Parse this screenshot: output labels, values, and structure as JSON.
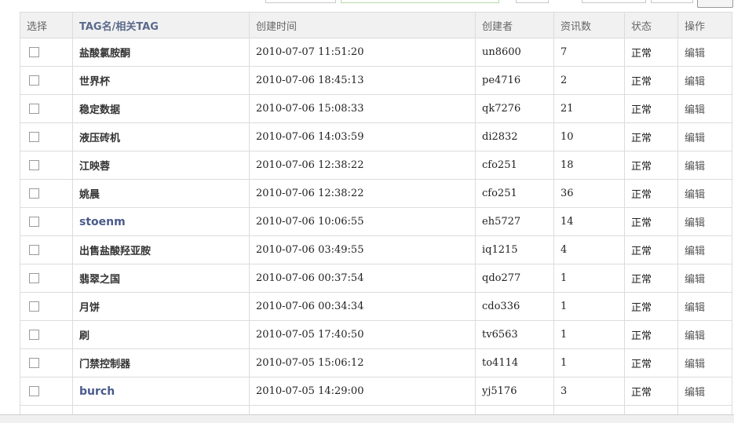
{
  "table": {
    "headers": {
      "select": "选择",
      "tag": "TAG名/相关TAG",
      "created": "创建时间",
      "creator": "创建者",
      "count": "资讯数",
      "status": "状态",
      "action": "操作"
    },
    "rows": [
      {
        "name": "盐酸氯胺酮",
        "time": "2010-07-07 11:51:20",
        "creator": "un8600",
        "count": "7",
        "status": "正常",
        "action": "编辑"
      },
      {
        "name": "世界杯",
        "time": "2010-07-06 18:45:13",
        "creator": "pe4716",
        "count": "2",
        "status": "正常",
        "action": "编辑"
      },
      {
        "name": "稳定数据",
        "time": "2010-07-06 15:08:33",
        "creator": "qk7276",
        "count": "21",
        "status": "正常",
        "action": "编辑"
      },
      {
        "name": "液压砖机",
        "time": "2010-07-06 14:03:59",
        "creator": "di2832",
        "count": "10",
        "status": "正常",
        "action": "编辑"
      },
      {
        "name": "江映蓉",
        "time": "2010-07-06 12:38:22",
        "creator": "cfo251",
        "count": "18",
        "status": "正常",
        "action": "编辑"
      },
      {
        "name": "姚晨",
        "time": "2010-07-06 12:38:22",
        "creator": "cfo251",
        "count": "36",
        "status": "正常",
        "action": "编辑"
      },
      {
        "name": "stoenm",
        "time": "2010-07-06 10:06:55",
        "creator": "eh5727",
        "count": "14",
        "status": "正常",
        "action": "编辑"
      },
      {
        "name": "出售盐酸羟亚胺",
        "time": "2010-07-06 03:49:55",
        "creator": "iq1215",
        "count": "4",
        "status": "正常",
        "action": "编辑"
      },
      {
        "name": "翡翠之国",
        "time": "2010-07-06 00:37:54",
        "creator": "qdo277",
        "count": "1",
        "status": "正常",
        "action": "编辑"
      },
      {
        "name": "月饼",
        "time": "2010-07-06 00:34:34",
        "creator": "cdo336",
        "count": "1",
        "status": "正常",
        "action": "编辑"
      },
      {
        "name": "刷",
        "time": "2010-07-05 17:40:50",
        "creator": "tv6563",
        "count": "1",
        "status": "正常",
        "action": "编辑"
      },
      {
        "name": "门禁控制器",
        "time": "2010-07-05 15:06:12",
        "creator": "to4114",
        "count": "1",
        "status": "正常",
        "action": "编辑"
      },
      {
        "name": "burch",
        "time": "2010-07-05 14:29:00",
        "creator": "yj5176",
        "count": "3",
        "status": "正常",
        "action": "编辑"
      }
    ]
  }
}
